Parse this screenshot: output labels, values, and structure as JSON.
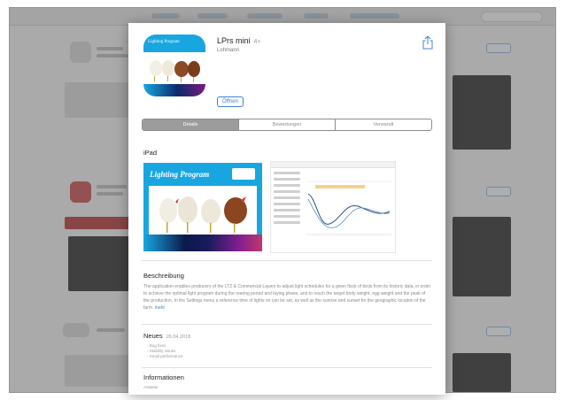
{
  "background": {
    "description_note": "",
    "colors": {
      "dim": "#5a5a5a",
      "accent": "#3c84d6"
    }
  },
  "app": {
    "name": "LPrs mini",
    "age_rating": "4+",
    "developer": "Lohmann",
    "price_button": "Öffnen",
    "icon": {
      "name": "app-icon",
      "caption": "Lighting Program"
    }
  },
  "tabs": [
    {
      "label": "Details",
      "active": true
    },
    {
      "label": "Bewertungen",
      "active": false
    },
    {
      "label": "Verwandt",
      "active": false
    }
  ],
  "screenshots": {
    "heading": "iPad",
    "shot1_title": "Lighting Program"
  },
  "description": {
    "heading": "Beschreibung",
    "text": "The application enables producers of the LTZ & Commercial Layers to adjust light schedules for a given flock of birds from its historic data, in order to achieve the optimal light program during the rearing period and laying phase, and to reach the target body weight, egg weight and the peak of the production. In the Settings menu a reference time of lights on can be set, as well as the sunrise and sunset for the geographic location of the farm.",
    "more": "mehr"
  },
  "news": {
    "heading": "Neues",
    "date": "26.04.2018",
    "items": [
      "- Bug fixes",
      "- Stability issues",
      "- Small performance"
    ]
  },
  "info": {
    "heading": "Informationen",
    "row_label": "Anbieter"
  }
}
